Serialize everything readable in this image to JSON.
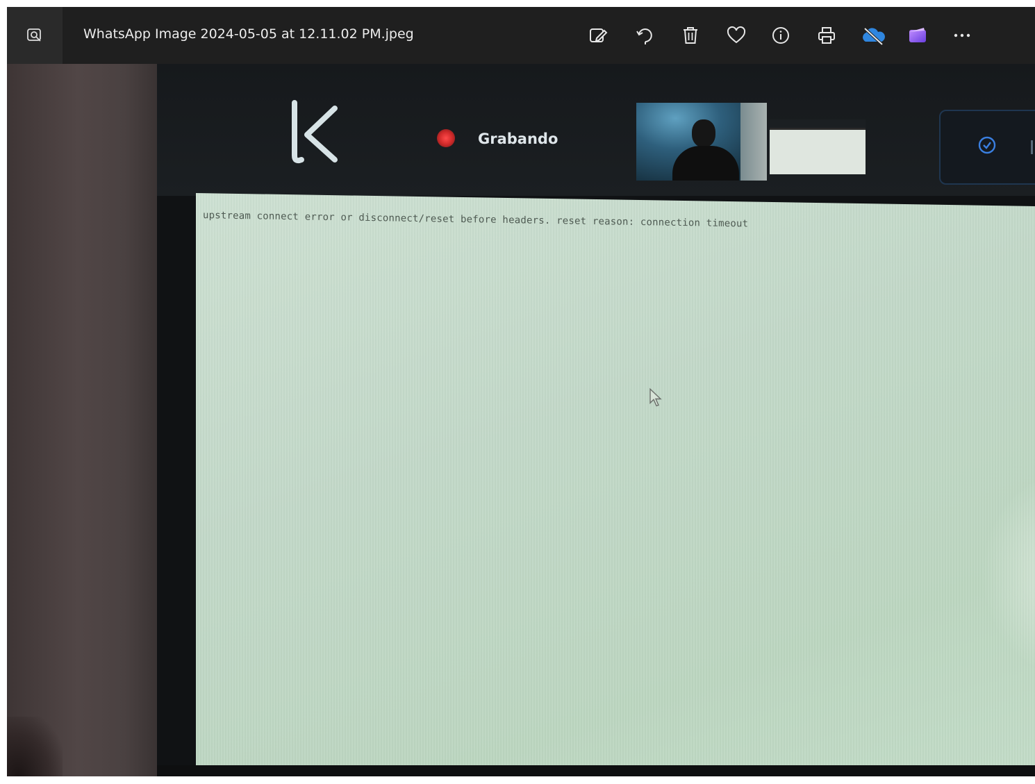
{
  "window": {
    "title": "WhatsApp Image 2024-05-05 at 12.11.02 PM.jpeg"
  },
  "toolbar": {
    "app_icon": "photos-viewer-icon",
    "buttons": [
      {
        "name": "edit-image-button",
        "icon": "edit-icon"
      },
      {
        "name": "rotate-button",
        "icon": "rotate-icon"
      },
      {
        "name": "delete-button",
        "icon": "trash-icon"
      },
      {
        "name": "favorite-button",
        "icon": "heart-icon"
      },
      {
        "name": "file-info-button",
        "icon": "info-icon"
      },
      {
        "name": "print-button",
        "icon": "printer-icon"
      },
      {
        "name": "onedrive-button",
        "icon": "onedrive-offline-icon"
      },
      {
        "name": "clipchamp-button",
        "icon": "clipchamp-icon"
      },
      {
        "name": "more-options-button",
        "icon": "more-dots-icon"
      }
    ]
  },
  "photo": {
    "recording_label": "Grabando",
    "error_message": "upstream connect error or disconnect/reset before headers. reset reason: connection timeout"
  },
  "colors": {
    "titlebar_bg": "#1f1f1f",
    "recording_red": "#e03a3a",
    "onedrive_blue": "#3a8fe0",
    "clipchamp_purple": "#8a5cf0",
    "screen_bg": "#c4dccb"
  }
}
